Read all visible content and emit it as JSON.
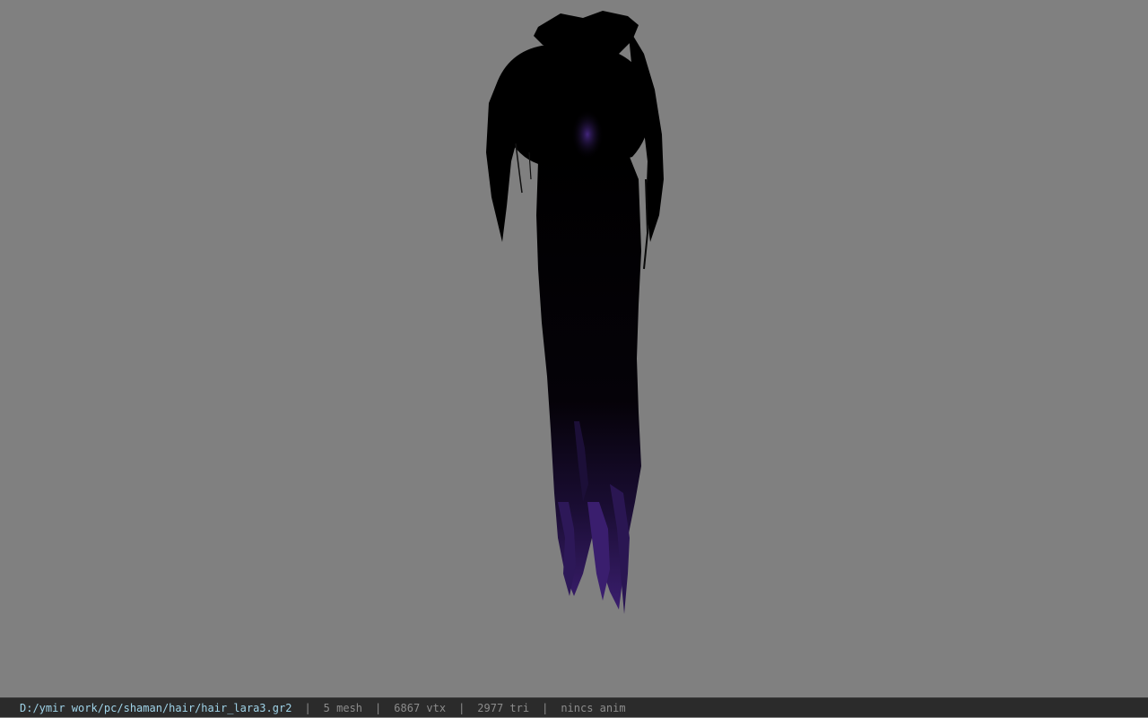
{
  "viewer": {
    "background_color": "#808080",
    "model_name": "hair_lara3",
    "model_colors": {
      "base": "#000000",
      "tint": "#3a1e6e",
      "tint_light": "#5a36a8"
    }
  },
  "statusbar": {
    "file_path": "D:/ymir work/pc/shaman/hair/hair_lara3.gr2",
    "separator": "|",
    "mesh": "5 mesh",
    "vertices": "6867 vtx",
    "triangles": "2977 tri",
    "animation": "nincs anim",
    "path_color": "#9fd3e8",
    "text_color": "#8c8c8c"
  }
}
